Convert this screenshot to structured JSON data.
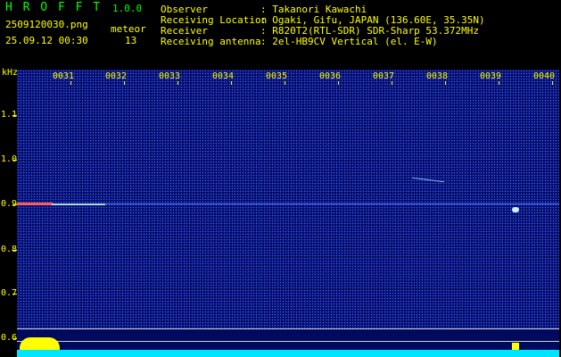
{
  "app": {
    "name": "H R O F F T",
    "version": "1.0.0"
  },
  "file": {
    "name": "2509120030.png",
    "datetime": "25.09.12 00:30"
  },
  "meteor": {
    "label": "meteor",
    "count": "13"
  },
  "info": [
    {
      "key": "Observer",
      "value": ": Takanori Kawachi"
    },
    {
      "key": "Receiving Location",
      "value": ": Ogaki, Gifu, JAPAN (136.60E, 35.35N)"
    },
    {
      "key": "Receiver",
      "value": ": R820T2(RTL-SDR) SDR-Sharp 53.372MHz"
    },
    {
      "key": "Receiving antenna",
      "value": ": 2el-HB9CV Vertical (el. E-W)"
    }
  ],
  "axis": {
    "unit": "kHz",
    "y_labels": [
      "1.1",
      "1.0",
      "0.9",
      "0.8",
      "0.7",
      "0.6"
    ],
    "x_labels": [
      "0031",
      "0032",
      "0033",
      "0034",
      "0035",
      "0036",
      "0037",
      "0038",
      "0039",
      "0040"
    ]
  },
  "colors": {
    "header_green": "#00ff00",
    "header_yellow": "#ffff00",
    "background": "#000a5c",
    "strip": "#00e5ff"
  }
}
